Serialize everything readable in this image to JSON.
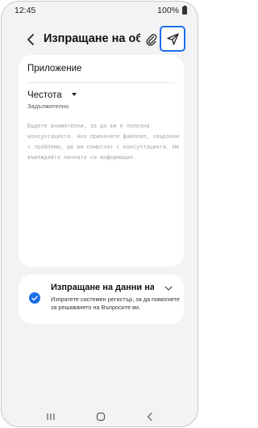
{
  "status_bar": {
    "time": "12:45",
    "battery": "100%"
  },
  "app_bar": {
    "title": "Изпращане на обратна връзка"
  },
  "form": {
    "app_label": "Приложение",
    "frequency_label": "Честота",
    "required_label": "Задължително",
    "notice": "Бъдете внимателни, за да ви е полезна консултацията. Ако прикачите файлове, свързани с проблема, ще ви помогнат с консултацията. Не въвеждайте личната си информация."
  },
  "consent": {
    "title": "Изпращане на данни на устройството",
    "description": "Изпратете системен регистър, за да помогнете за решаването на Въпросите ви.",
    "checked": true
  },
  "nav_bar": {
    "items": [
      "recents-icon",
      "home-icon",
      "back-icon"
    ]
  },
  "colors": {
    "accent": "#1a6ee8",
    "background": "#f3f3f5"
  }
}
